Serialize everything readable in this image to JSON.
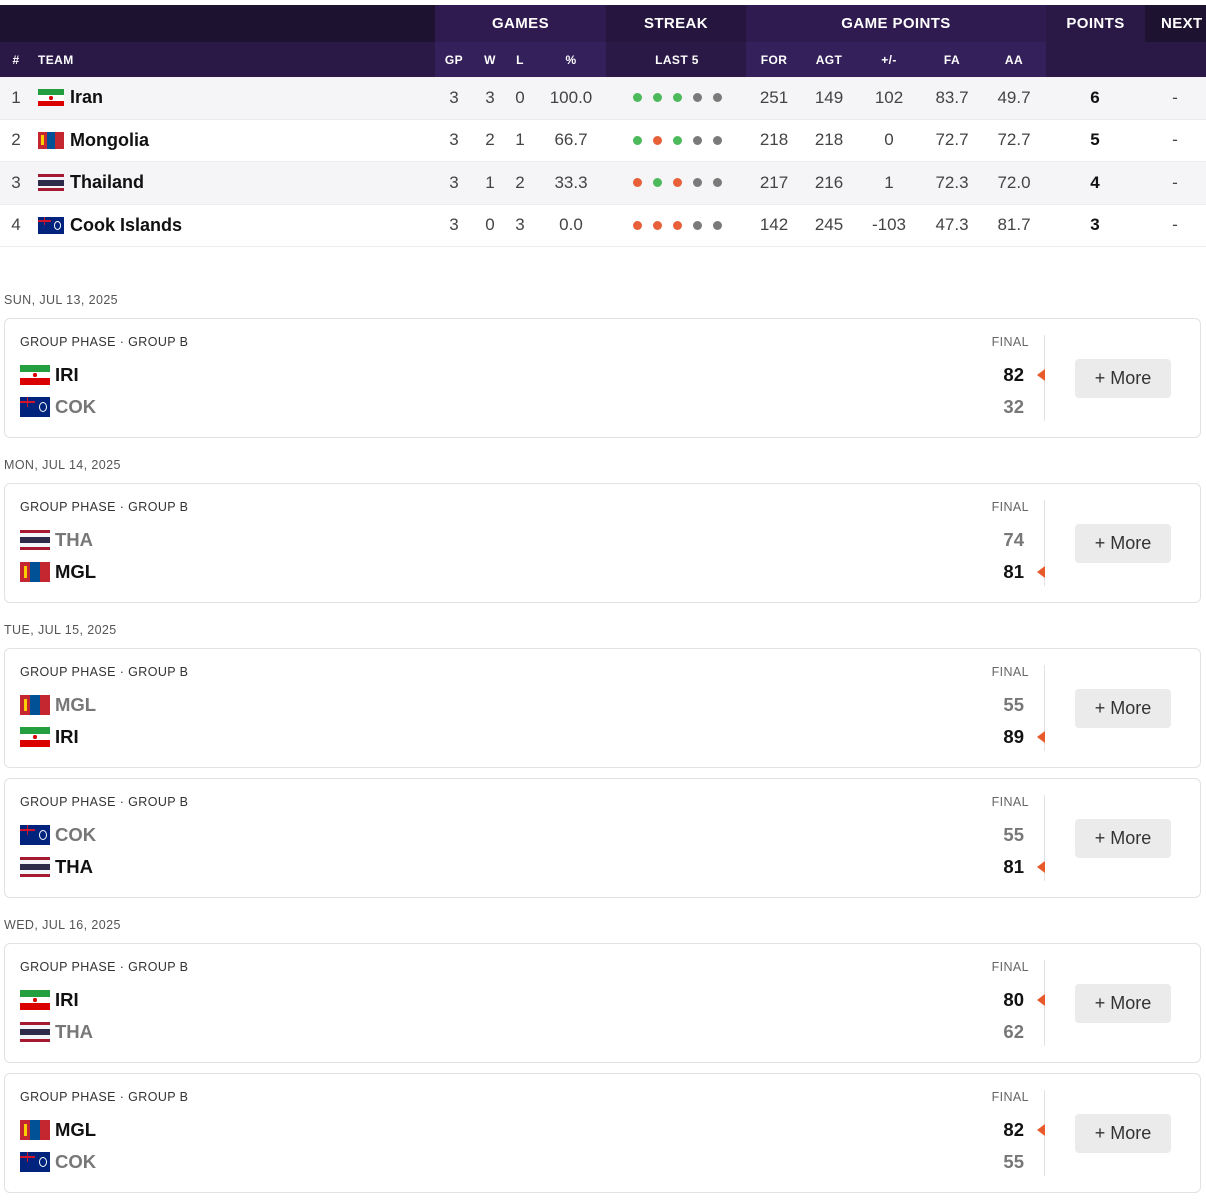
{
  "standings": {
    "group_headers": {
      "games": "GAMES",
      "streak": "STREAK",
      "game_points": "GAME POINTS",
      "points": "POINTS",
      "next": "NEXT"
    },
    "columns": {
      "rank": "#",
      "team": "TEAM",
      "gp": "GP",
      "w": "W",
      "l": "L",
      "pct": "%",
      "last5": "LAST 5",
      "for": "FOR",
      "agt": "AGT",
      "diff": "+/-",
      "fa": "FA",
      "aa": "AA"
    },
    "rows": [
      {
        "rank": "1",
        "team": "Iran",
        "flag": "iran-flag-icon",
        "gp": "3",
        "w": "3",
        "l": "0",
        "pct": "100.0",
        "streak": [
          "win",
          "win",
          "win",
          "none",
          "none"
        ],
        "for": "251",
        "agt": "149",
        "diff": "102",
        "fa": "83.7",
        "aa": "49.7",
        "points": "6",
        "next": "-"
      },
      {
        "rank": "2",
        "team": "Mongolia",
        "flag": "mongolia-flag-icon",
        "gp": "3",
        "w": "2",
        "l": "1",
        "pct": "66.7",
        "streak": [
          "win",
          "loss",
          "win",
          "none",
          "none"
        ],
        "for": "218",
        "agt": "218",
        "diff": "0",
        "fa": "72.7",
        "aa": "72.7",
        "points": "5",
        "next": "-"
      },
      {
        "rank": "3",
        "team": "Thailand",
        "flag": "thailand-flag-icon",
        "gp": "3",
        "w": "1",
        "l": "2",
        "pct": "33.3",
        "streak": [
          "loss",
          "win",
          "loss",
          "none",
          "none"
        ],
        "for": "217",
        "agt": "216",
        "diff": "1",
        "fa": "72.3",
        "aa": "72.0",
        "points": "4",
        "next": "-"
      },
      {
        "rank": "4",
        "team": "Cook Islands",
        "flag": "cook-islands-flag-icon",
        "gp": "3",
        "w": "0",
        "l": "3",
        "pct": "0.0",
        "streak": [
          "loss",
          "loss",
          "loss",
          "none",
          "none"
        ],
        "for": "142",
        "agt": "245",
        "diff": "-103",
        "fa": "47.3",
        "aa": "81.7",
        "points": "3",
        "next": "-"
      }
    ]
  },
  "colors": {
    "header_dark": "#1e1231",
    "header_sub": "#2a1846",
    "streak_win": "#4cba5a",
    "streak_loss": "#e8603a",
    "streak_none": "#7a7a7a",
    "win_arrow": "#e85a2a"
  },
  "schedule": {
    "more_label": "+ More",
    "final_label": "FINAL",
    "phase_label": "GROUP PHASE · GROUP B",
    "days": [
      {
        "date": "SUN, JUL 13, 2025",
        "games": [
          {
            "teams": [
              {
                "abbr": "IRI",
                "flag": "iran",
                "score": "82",
                "win": true
              },
              {
                "abbr": "COK",
                "flag": "cook",
                "score": "32",
                "win": false
              }
            ]
          }
        ]
      },
      {
        "date": "MON, JUL 14, 2025",
        "games": [
          {
            "teams": [
              {
                "abbr": "THA",
                "flag": "thailand",
                "score": "74",
                "win": false
              },
              {
                "abbr": "MGL",
                "flag": "mongolia",
                "score": "81",
                "win": true
              }
            ]
          }
        ]
      },
      {
        "date": "TUE, JUL 15, 2025",
        "games": [
          {
            "teams": [
              {
                "abbr": "MGL",
                "flag": "mongolia",
                "score": "55",
                "win": false
              },
              {
                "abbr": "IRI",
                "flag": "iran",
                "score": "89",
                "win": true
              }
            ]
          },
          {
            "teams": [
              {
                "abbr": "COK",
                "flag": "cook",
                "score": "55",
                "win": false
              },
              {
                "abbr": "THA",
                "flag": "thailand",
                "score": "81",
                "win": true
              }
            ]
          }
        ]
      },
      {
        "date": "WED, JUL 16, 2025",
        "games": [
          {
            "teams": [
              {
                "abbr": "IRI",
                "flag": "iran",
                "score": "80",
                "win": true
              },
              {
                "abbr": "THA",
                "flag": "thailand",
                "score": "62",
                "win": false
              }
            ]
          },
          {
            "teams": [
              {
                "abbr": "MGL",
                "flag": "mongolia",
                "score": "82",
                "win": true
              },
              {
                "abbr": "COK",
                "flag": "cook",
                "score": "55",
                "win": false
              }
            ]
          }
        ]
      }
    ]
  }
}
